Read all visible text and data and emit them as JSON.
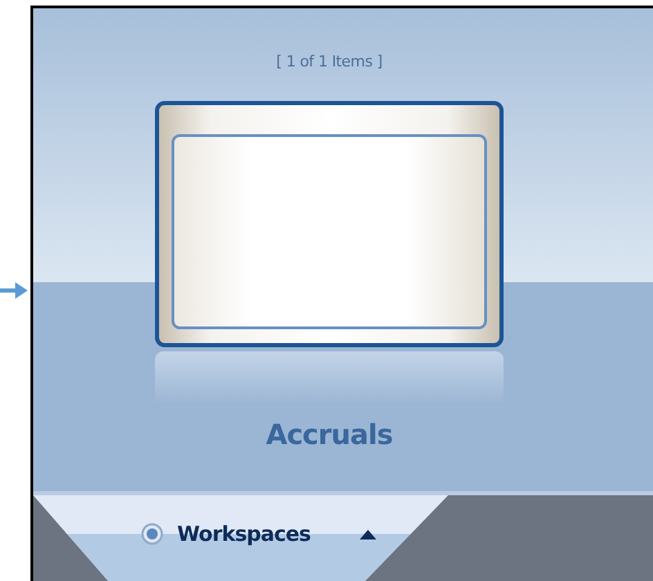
{
  "counter": "[ 1 of 1 Items ]",
  "items": [
    {
      "label": "Accruals",
      "selected": true
    }
  ],
  "workspaces_tab": {
    "label": "Workspaces",
    "expanded": false
  }
}
